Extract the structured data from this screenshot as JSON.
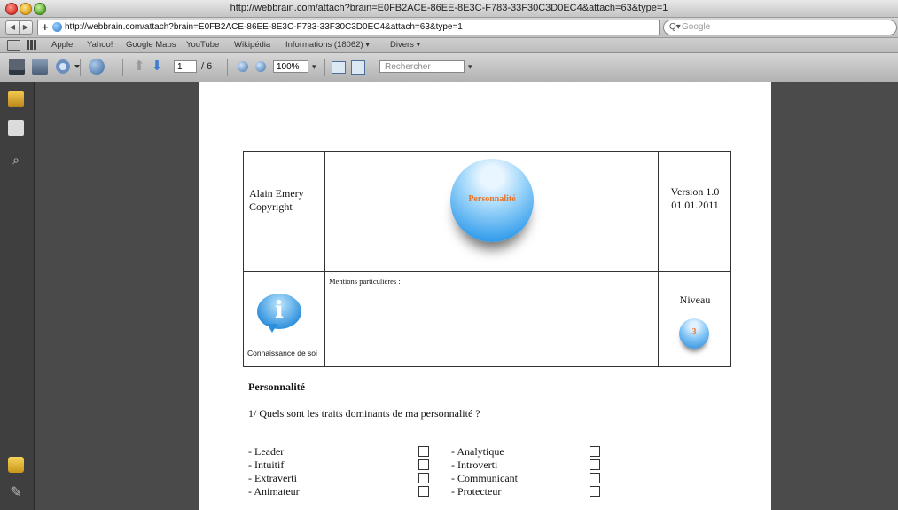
{
  "window": {
    "title": "http://webbrain.com/attach?brain=E0FB2ACE-86EE-8E3C-F783-33F30C3D0EC4&attach=63&type=1"
  },
  "address_bar": {
    "url": "http://webbrain.com/attach?brain=E0FB2ACE-86EE-8E3C-F783-33F30C3D0EC4&attach=63&type=1",
    "reload": "C",
    "search_placeholder": "Google"
  },
  "bookmarks": {
    "items": [
      "Apple",
      "Yahoo!",
      "Google Maps",
      "YouTube",
      "Wikipédia",
      "Informations (18062) ▾",
      "Divers ▾"
    ]
  },
  "pdf_toolbar": {
    "page_current": "1",
    "page_total": "/ 6",
    "zoom": "100%",
    "find_placeholder": "Rechercher"
  },
  "document": {
    "author_line1": "Alain Emery",
    "author_line2": "Copyright",
    "orb_label": "Personnalité",
    "version_line1": "Version 1.0",
    "version_line2": "01.01.2011",
    "info_label": "Connaissance de soi",
    "mentions_label": "Mentions particulières :",
    "niveau_label": "Niveau",
    "niveau_value": "3",
    "section_title": "Personnalité",
    "question": "1/ Quels sont les traits dominants de ma personnalité ?",
    "traits_left": [
      "- Leader",
      "- Intuitif",
      "- Extraverti",
      "- Animateur"
    ],
    "traits_right": [
      "- Analytique",
      "- Introverti",
      "- Communicant",
      "- Protecteur"
    ]
  },
  "colors": {
    "orb_blue": "#3aa0ec",
    "orb_text": "#e8742a"
  }
}
